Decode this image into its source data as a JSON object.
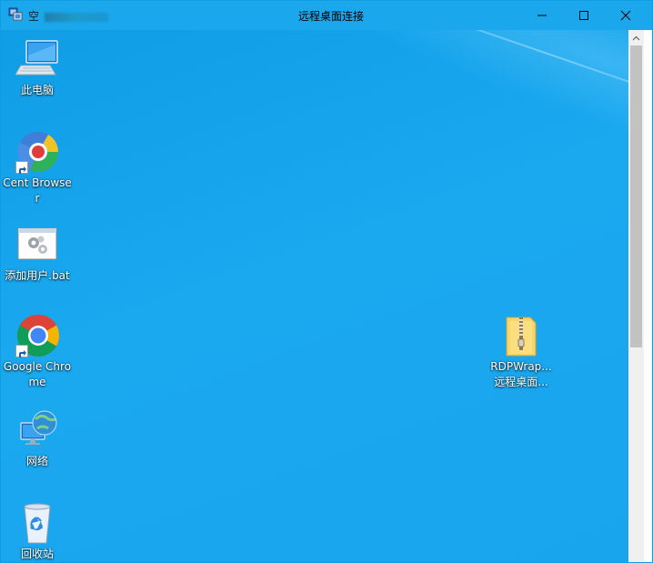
{
  "window": {
    "title": "远程桌面连接",
    "left_title_prefix": "空",
    "accent_color": "#1aa7ec",
    "icon": "remote-desktop-icon"
  },
  "controls": {
    "minimize_icon": "minimize-icon",
    "maximize_icon": "maximize-icon",
    "close_icon": "close-icon"
  },
  "desktop": {
    "background_color": "#1aa8ef",
    "icons": [
      {
        "label": "此电脑",
        "icon": "computer-icon"
      },
      {
        "label": "Cent Browser",
        "icon": "cent-browser-icon",
        "shortcut": true
      },
      {
        "label": "添加用户.bat",
        "icon": "batch-file-icon"
      },
      {
        "label": "Google Chrome",
        "icon": "chrome-icon",
        "shortcut": true
      },
      {
        "label": "网络",
        "icon": "network-icon"
      },
      {
        "label": "回收站",
        "icon": "recycle-bin-icon"
      },
      {
        "label_line1": "RDPWrap...",
        "label_line2": "远程桌面...",
        "icon": "zip-folder-icon"
      }
    ]
  }
}
